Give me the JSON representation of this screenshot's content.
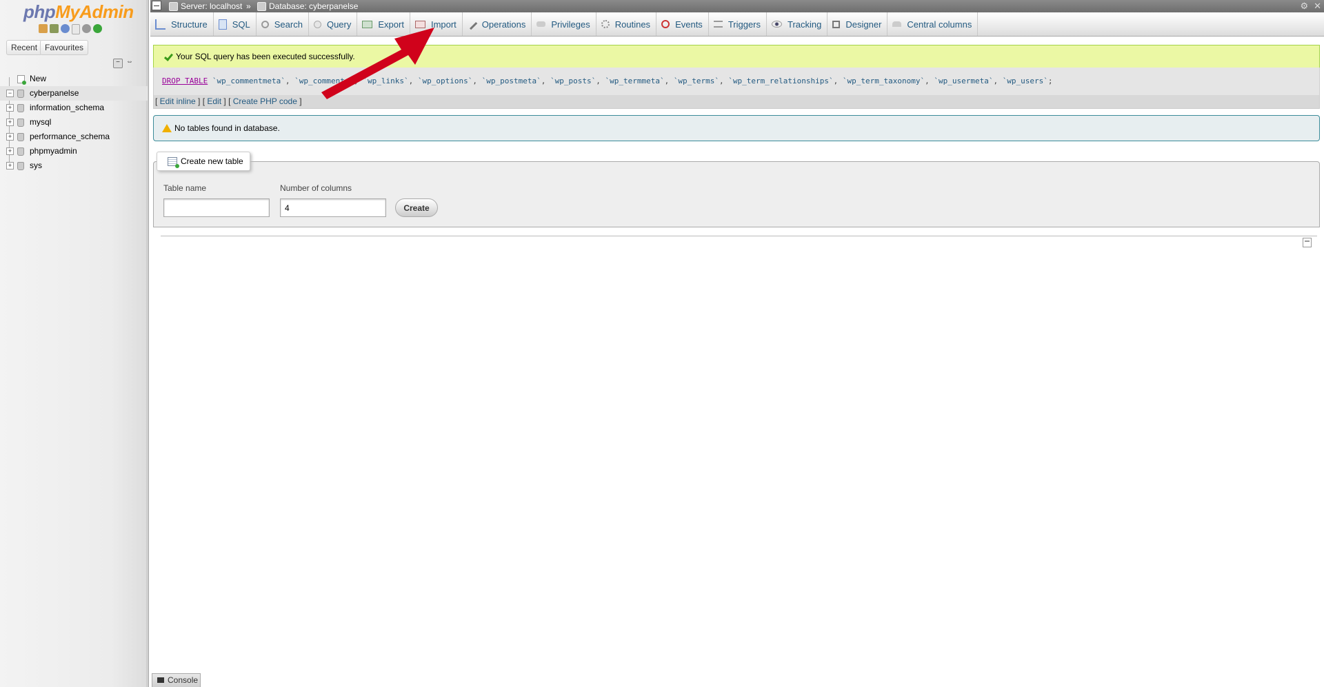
{
  "logo": {
    "part1": "php",
    "part2": "MyAdmin"
  },
  "nav": {
    "recent_label": "Recent",
    "favourites_label": "Favourites",
    "new_label": "New",
    "databases": [
      "cyberpanelse",
      "information_schema",
      "mysql",
      "performance_schema",
      "phpmyadmin",
      "sys"
    ],
    "active_db": "cyberpanelse"
  },
  "breadcrumb": {
    "server": "Server: localhost",
    "separator": "»",
    "database": "Database: cyberpanelse"
  },
  "tabs": [
    {
      "label": "Structure",
      "icon": "structure-icon"
    },
    {
      "label": "SQL",
      "icon": "sql-icon"
    },
    {
      "label": "Search",
      "icon": "search-icon"
    },
    {
      "label": "Query",
      "icon": "query-icon"
    },
    {
      "label": "Export",
      "icon": "export-icon"
    },
    {
      "label": "Import",
      "icon": "import-icon"
    },
    {
      "label": "Operations",
      "icon": "operations-icon"
    },
    {
      "label": "Privileges",
      "icon": "privileges-icon"
    },
    {
      "label": "Routines",
      "icon": "routines-icon"
    },
    {
      "label": "Events",
      "icon": "events-icon"
    },
    {
      "label": "Triggers",
      "icon": "triggers-icon"
    },
    {
      "label": "Tracking",
      "icon": "tracking-icon"
    },
    {
      "label": "Designer",
      "icon": "designer-icon"
    },
    {
      "label": "Central columns",
      "icon": "central-columns-icon"
    }
  ],
  "success_message": "Your SQL query has been executed successfully.",
  "sql": {
    "keyword": "DROP TABLE",
    "tables": [
      "`wp_commentmeta`",
      "`wp_comments`",
      "`wp_links`",
      "`wp_options`",
      "`wp_postmeta`",
      "`wp_posts`",
      "`wp_termmeta`",
      "`wp_terms`",
      "`wp_term_relationships`",
      "`wp_term_taxonomy`",
      "`wp_usermeta`",
      "`wp_users`"
    ],
    "terminator": ";"
  },
  "sql_links": {
    "edit_inline": "Edit inline",
    "edit": "Edit",
    "create_php": "Create PHP code"
  },
  "notice_message": "No tables found in database.",
  "create_table": {
    "legend": "Create new table",
    "table_name_label": "Table name",
    "table_name_value": "",
    "num_columns_label": "Number of columns",
    "num_columns_value": "4",
    "create_button": "Create"
  },
  "console_label": "Console",
  "colors": {
    "link": "#235a81",
    "success_bg": "#ebf8a4",
    "notice_border": "#3b8c99",
    "annotation_arrow": "#d0021b"
  }
}
